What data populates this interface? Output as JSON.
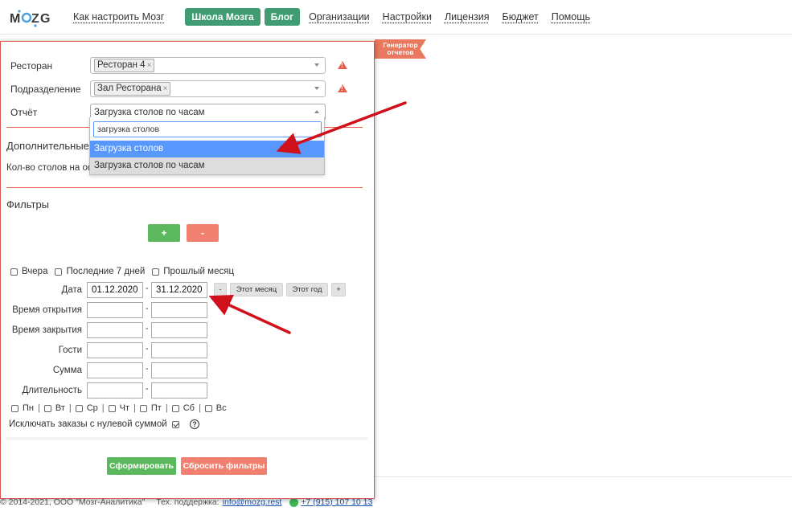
{
  "nav": {
    "logo": "MOZG",
    "links": [
      "Как настроить Мозг"
    ],
    "pills": [
      "Школа Мозга",
      "Блог"
    ],
    "links2": [
      "Организации",
      "Настройки",
      "Лицензия",
      "Бюджет",
      "Помощь"
    ]
  },
  "ribbon": {
    "line1": "Генератор",
    "line2": "отчетов"
  },
  "form": {
    "restaurant_label": "Ресторан",
    "restaurant_tag": "Ресторан 4",
    "division_label": "Подразделение",
    "division_tag": "Зал Ресторана",
    "report_label": "Отчёт",
    "report_value": "Загрузка столов по часам",
    "tag_remove": "×"
  },
  "dropdown": {
    "search_value": "загрузка столов",
    "options": [
      "Загрузка столов",
      "Загрузка столов по часам"
    ]
  },
  "additional": {
    "heading": "Дополнительные",
    "field": "Кол-во столов на оф"
  },
  "filters": {
    "heading": "Фильтры",
    "add": "+",
    "remove": "-",
    "quick": [
      "Вчера",
      "Последние 7 дней",
      "Прошлый месяц"
    ],
    "date_label": "Дата",
    "date_from": "01.12.2020",
    "date_to": "31.12.2020",
    "dash": "-",
    "date_buttons": [
      "-",
      "Этот месяц",
      "Этот год",
      "+"
    ],
    "rows": [
      "Время открытия",
      "Время закрытия",
      "Гости",
      "Сумма",
      "Длительность"
    ],
    "days": [
      "Пн",
      "Вт",
      "Ср",
      "Чт",
      "Пт",
      "Сб",
      "Вс"
    ],
    "day_sep": "|",
    "exclude_zero": "Исключать заказы с нулевой суммой",
    "help": "?"
  },
  "actions": {
    "submit": "Сформировать",
    "reset": "Сбросить фильтры"
  },
  "footer": {
    "copyright": "© 2014-2021, ООО \"Мозг-Аналитика\"",
    "support": "Тех. поддержка:",
    "email": "info@mozg.rest",
    "phone": "+7 (915) 107 10 13"
  },
  "colors": {
    "green": "#3f9c73",
    "red": "#e45e4b",
    "select_blue": "#5897fb",
    "arrow": "#d0111b"
  }
}
